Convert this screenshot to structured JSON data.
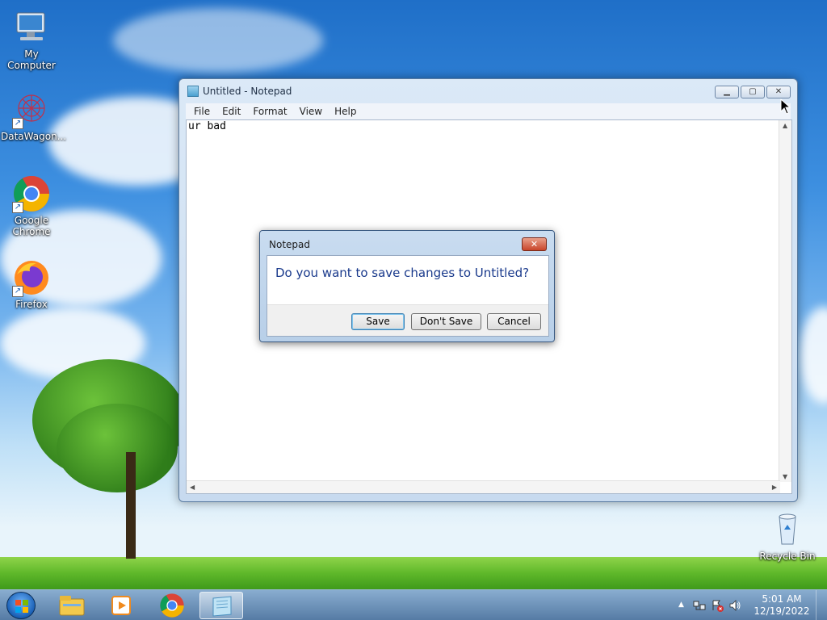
{
  "desktop": {
    "icons": [
      {
        "label": "My Computer",
        "icon": "computer-icon"
      },
      {
        "label": "DataWagon...",
        "icon": "datawagon-icon"
      },
      {
        "label": "Google Chrome",
        "icon": "chrome-icon"
      },
      {
        "label": "Firefox",
        "icon": "firefox-icon"
      },
      {
        "label": "Recycle Bin",
        "icon": "recycle-bin-icon"
      }
    ]
  },
  "notepad": {
    "title": "Untitled - Notepad",
    "menu": [
      "File",
      "Edit",
      "Format",
      "View",
      "Help"
    ],
    "content": "ur bad",
    "buttons": {
      "minimize": "▁",
      "maximize": "▢",
      "close": "✕"
    }
  },
  "dialog": {
    "title": "Notepad",
    "message": "Do you want to save changes to Untitled?",
    "save_label": "Save",
    "dont_save_label": "Don't Save",
    "cancel_label": "Cancel",
    "close_glyph": "✕"
  },
  "taskbar": {
    "items": [
      "explorer-icon",
      "media-player-icon",
      "chrome-icon",
      "notepad-icon"
    ],
    "clock": {
      "time": "5:01 AM",
      "date": "12/19/2022"
    },
    "tray": [
      "show-hidden-icon",
      "network-icon",
      "action-center-icon",
      "volume-icon"
    ]
  },
  "colors": {
    "dialog_text": "#1a3a8c",
    "taskbar": "#4a7aaa"
  }
}
